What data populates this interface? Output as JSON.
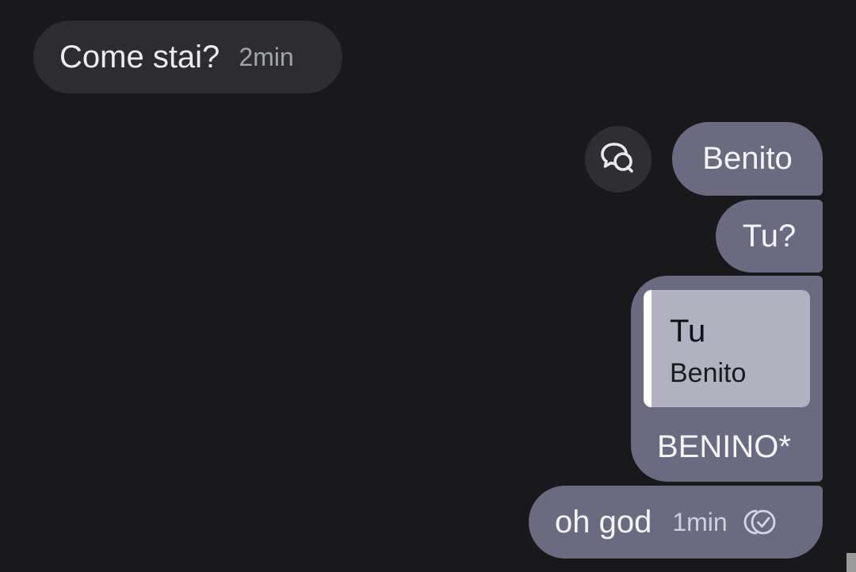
{
  "chat": {
    "messages": [
      {
        "direction": "incoming",
        "text": "Come stai?",
        "time": "2min"
      },
      {
        "direction": "outgoing",
        "text": "Benito"
      },
      {
        "direction": "outgoing",
        "text": "Tu?"
      },
      {
        "direction": "outgoing",
        "quote": {
          "author": "Tu",
          "text": "Benito"
        },
        "text": "BENINO*"
      },
      {
        "direction": "outgoing",
        "text": "oh god",
        "time": "1min",
        "status_icon": "double-check-read-icon"
      }
    ],
    "reply_action_icon": "reply-chat-icon"
  },
  "colors": {
    "background": "#19191b",
    "incoming_bubble": "#2d2d30",
    "outgoing_bubble": "#6a6a80",
    "quote_card": "#b2b1bf",
    "quote_bar": "#ffffff"
  }
}
